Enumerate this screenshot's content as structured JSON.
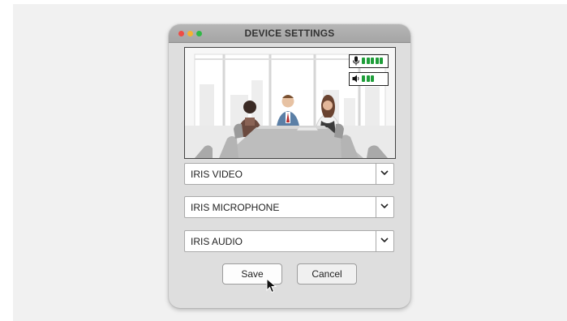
{
  "window": {
    "title": "DEVICE SETTINGS",
    "traffic_lights": {
      "close": "#ee4c45",
      "minimize": "#f5b331",
      "zoom": "#2fb846"
    }
  },
  "preview": {
    "scene": "meeting-room-video-feed",
    "mic_meter": {
      "icon": "microphone-icon",
      "level_bars": 5,
      "max_bars": 5
    },
    "speaker_meter": {
      "icon": "speaker-icon",
      "level_bars": 3,
      "max_bars": 5
    },
    "level_color": "#1f9e3a"
  },
  "devices": {
    "video": {
      "selected": "IRIS VIDEO"
    },
    "microphone": {
      "selected": "IRIS MICROPHONE"
    },
    "audio": {
      "selected": "IRIS AUDIO"
    }
  },
  "buttons": {
    "save_label": "Save",
    "cancel_label": "Cancel"
  }
}
